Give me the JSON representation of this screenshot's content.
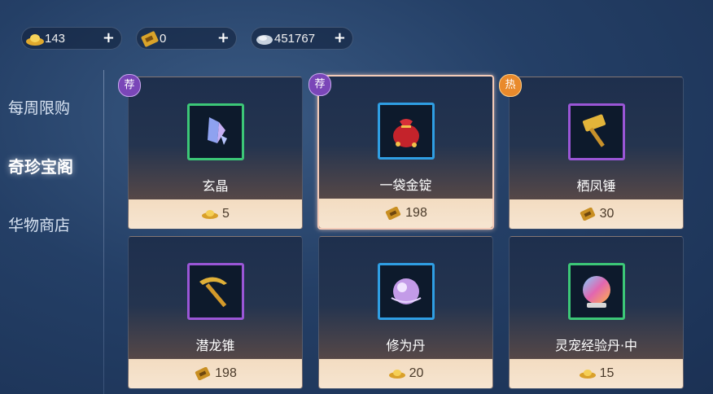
{
  "currencies": [
    {
      "icon": "gold-ingot-icon",
      "amount": "143"
    },
    {
      "icon": "gold-ticket-icon",
      "amount": "0"
    },
    {
      "icon": "silver-icon",
      "amount": "451767"
    }
  ],
  "plus_label": "+",
  "sidebar": {
    "items": [
      {
        "label": "每周限购",
        "active": false
      },
      {
        "label": "奇珍宝阁",
        "active": true
      },
      {
        "label": "华物商店",
        "active": false
      }
    ]
  },
  "shop": {
    "items": [
      {
        "name": "玄晶",
        "price": "5",
        "currency": "gold-ingot-icon",
        "badge": "荐",
        "frame": "green",
        "icon": "crystal-icon"
      },
      {
        "name": "一袋金锭",
        "price": "198",
        "currency": "gold-ticket-icon",
        "badge": "荐",
        "frame": "blue",
        "icon": "money-bag-icon",
        "selected": true
      },
      {
        "name": "栖凤锤",
        "price": "30",
        "currency": "gold-ticket-icon",
        "badge": "热",
        "frame": "purple",
        "icon": "hammer-icon"
      },
      {
        "name": "潜龙锥",
        "price": "198",
        "currency": "gold-ticket-icon",
        "badge": "",
        "frame": "purple",
        "icon": "pickaxe-icon"
      },
      {
        "name": "修为丹",
        "price": "20",
        "currency": "gold-ingot-icon",
        "badge": "",
        "frame": "blue",
        "icon": "pill-orb-icon"
      },
      {
        "name": "灵宠经验丹·中",
        "price": "15",
        "currency": "gold-ingot-icon",
        "badge": "",
        "frame": "green",
        "icon": "exp-orb-icon"
      }
    ]
  },
  "colors": {
    "frame_green": "#3cc777",
    "frame_blue": "#2f9ee3",
    "frame_purple": "#9a56d6",
    "selected_border": "#f4cbb8"
  }
}
